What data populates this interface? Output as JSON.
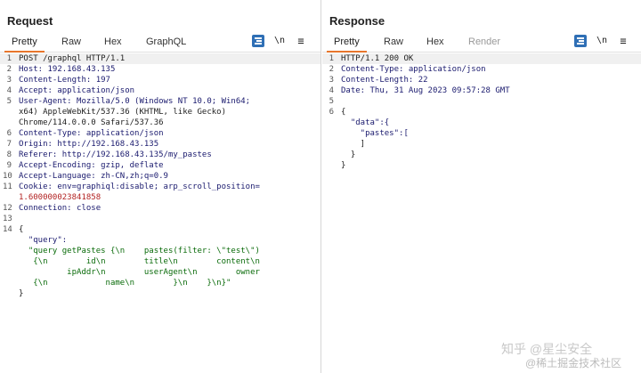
{
  "layout_switch": {
    "icons": [
      "split-columns-icon",
      "split-rows-icon",
      "single-pane-icon"
    ],
    "active_color": "#2f6fb5"
  },
  "request": {
    "title": "Request",
    "tabs": [
      "Pretty",
      "Raw",
      "Hex",
      "GraphQL"
    ],
    "active_tab": "Pretty",
    "tools": {
      "newline": "\\n",
      "menu": "≡"
    },
    "line_numbers": [
      "1",
      "2",
      "3",
      "4",
      "5",
      "",
      "",
      "6",
      "7",
      "8",
      "9",
      "10",
      "11",
      "",
      "12",
      "13",
      "14",
      "",
      "",
      "",
      "",
      "",
      "",
      ""
    ],
    "lines": [
      "POST /graphql HTTP/1.1",
      "Host: 192.168.43.135",
      "Content-Length: 197",
      "Accept: application/json",
      "User-Agent: Mozilla/5.0 (Windows NT 10.0; Win64;",
      "x64) AppleWebKit/537.36 (KHTML, like Gecko)",
      "Chrome/114.0.0.0 Safari/537.36",
      "Content-Type: application/json",
      "Origin: http://192.168.43.135",
      "Referer: http://192.168.43.135/my_pastes",
      "Accept-Encoding: gzip, deflate",
      "Accept-Language: zh-CN,zh;q=0.9",
      "Cookie: env=graphiql:disable; arp_scroll_position=",
      "1.600000023841858",
      "Connection: close",
      "",
      "{",
      "  \"query\":",
      "  \"query getPastes {\\n    pastes(filter: \\\"test\\\")",
      "   {\\n        id\\n        title\\n        content\\n",
      "          ipAddr\\n        userAgent\\n        owner",
      "   {\\n            name\\n        }\\n    }\\n}\"",
      "}",
      ""
    ]
  },
  "response": {
    "title": "Response",
    "tabs": [
      "Pretty",
      "Raw",
      "Hex",
      "Render"
    ],
    "active_tab": "Pretty",
    "tools": {
      "newline": "\\n",
      "menu": "≡"
    },
    "line_numbers": [
      "1",
      "2",
      "3",
      "4",
      "5",
      "6",
      "",
      "",
      "",
      "",
      ""
    ],
    "lines": [
      "HTTP/1.1 200 OK",
      "Content-Type: application/json",
      "Content-Length: 22",
      "Date: Thu, 31 Aug 2023 09:57:28 GMT",
      "",
      "{",
      "  \"data\":{",
      "    \"pastes\":[",
      "    ]",
      "  }",
      "}"
    ]
  },
  "watermark": {
    "line1": "知乎 @星尘安全",
    "line2": "@稀土掘金技术社区"
  }
}
